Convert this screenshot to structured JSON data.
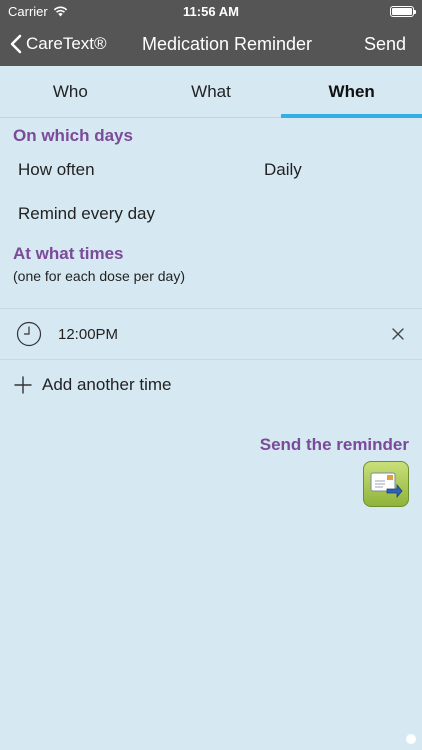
{
  "status": {
    "carrier": "Carrier",
    "time": "11:56 AM"
  },
  "nav": {
    "back_label": "CareText®",
    "title": "Medication Reminder",
    "send_label": "Send"
  },
  "tabs": [
    {
      "label": "Who"
    },
    {
      "label": "What"
    },
    {
      "label": "When",
      "active": true
    }
  ],
  "days": {
    "title": "On which days",
    "how_often_label": "How often",
    "how_often_value": "Daily",
    "remind_label": "Remind every day"
  },
  "times": {
    "title": "At what times",
    "note": "(one for each dose per day)",
    "entries": [
      {
        "time": "12:00PM"
      }
    ],
    "add_label": "Add another time"
  },
  "send_reminder": {
    "label": "Send the reminder"
  },
  "colors": {
    "accent": "#35aee8",
    "heading": "#7b4a98",
    "background": "#d6e9f3",
    "bar": "#555555"
  }
}
